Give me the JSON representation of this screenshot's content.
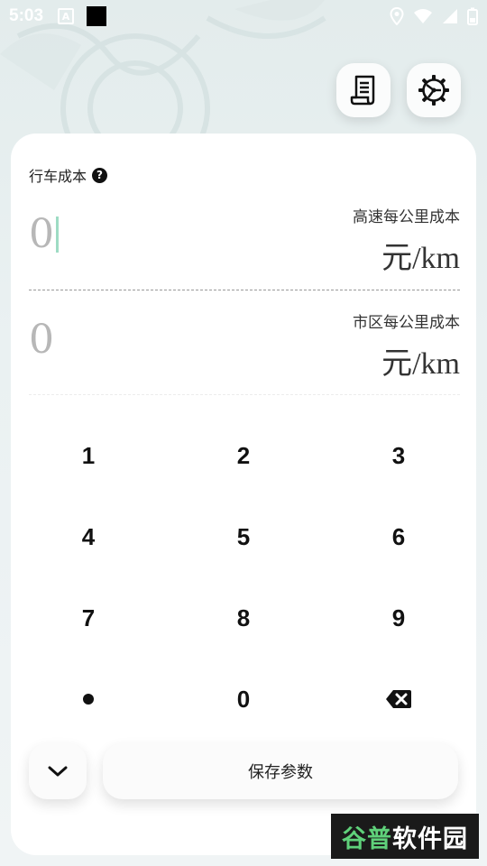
{
  "status_bar": {
    "time": "5:03"
  },
  "section": {
    "title": "行车成本"
  },
  "fields": [
    {
      "value": "0",
      "label": "高速每公里成本",
      "unit": "元/km"
    },
    {
      "value": "0",
      "label": "市区每公里成本",
      "unit": "元/km"
    }
  ],
  "keypad": {
    "keys": [
      "1",
      "2",
      "3",
      "4",
      "5",
      "6",
      "7",
      "8",
      "9",
      "0"
    ]
  },
  "bottom": {
    "save_label": "保存参数"
  },
  "watermark": {
    "text": "谷普软件园"
  },
  "colors": {
    "caret": "#9edcc4",
    "accent": "#111111",
    "card": "#ffffff"
  }
}
